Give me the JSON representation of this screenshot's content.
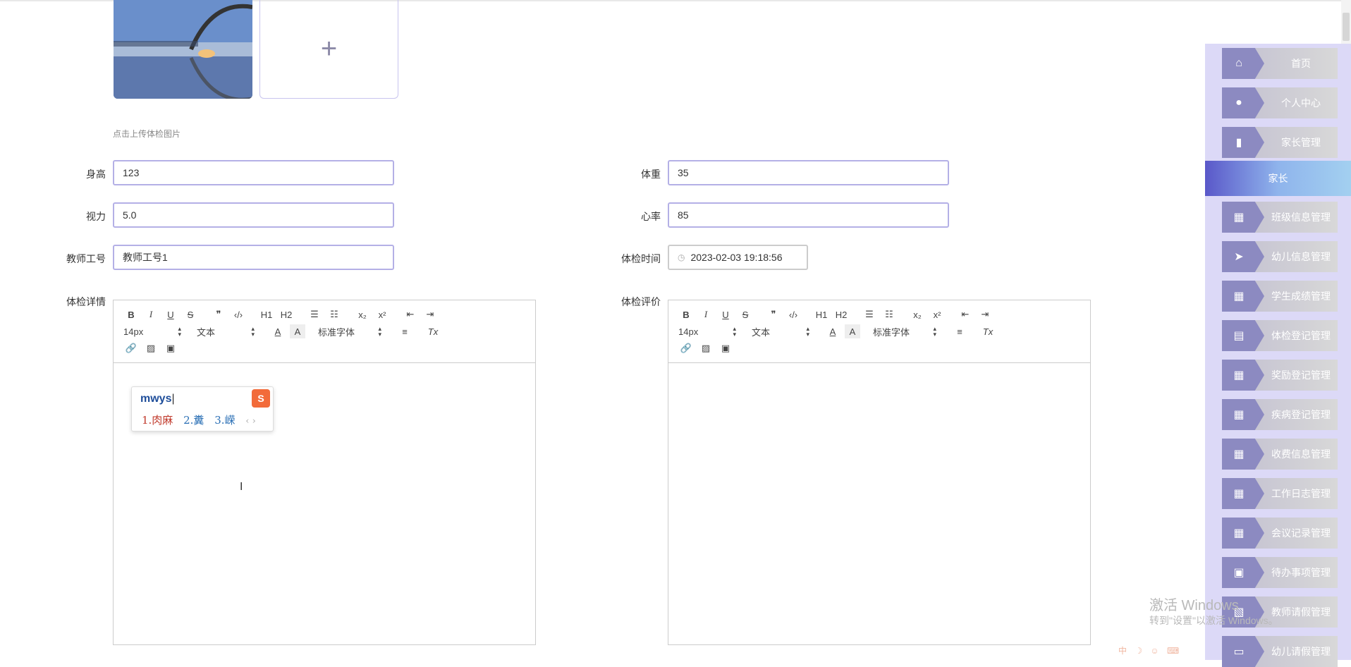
{
  "upload": {
    "hint": "点击上传体检图片",
    "add_symbol": "+"
  },
  "form": {
    "height": {
      "label": "身高",
      "value": "123"
    },
    "weight": {
      "label": "体重",
      "value": "35"
    },
    "vision": {
      "label": "视力",
      "value": "5.0"
    },
    "heart_rate": {
      "label": "心率",
      "value": "85"
    },
    "teacher_id": {
      "label": "教师工号",
      "value": "教师工号1"
    },
    "exam_time": {
      "label": "体检时间",
      "value": "2023-02-03 19:18:56"
    },
    "details": {
      "label": "体检详情"
    },
    "evaluation": {
      "label": "体检评价"
    }
  },
  "editor": {
    "font_size": "14px",
    "paragraph": "文本",
    "font_family": "标准字体",
    "buttons": {
      "bold": "B",
      "italic": "I",
      "underline": "U",
      "strike": "S",
      "quote": "❞",
      "code": "‹/›",
      "h1": "H1",
      "h2": "H2",
      "sub": "x₂",
      "sup": "x²",
      "clean": "Tx"
    }
  },
  "ime": {
    "input": "mwys",
    "candidates": [
      "1.肉麻",
      "2.糞",
      "3.嵘"
    ],
    "nav": "‹ ›",
    "logo": "S"
  },
  "sidebar": {
    "items_top": [
      {
        "label": "首页",
        "icon": "home-icon",
        "glyph": "⌂"
      },
      {
        "label": "个人中心",
        "icon": "user-icon",
        "glyph": "●"
      },
      {
        "label": "家长管理",
        "icon": "bar-chart-icon",
        "glyph": "▮"
      }
    ],
    "active": "家长",
    "items_bottom": [
      {
        "label": "班级信息管理",
        "icon": "grid-icon",
        "glyph": "▦"
      },
      {
        "label": "幼儿信息管理",
        "icon": "send-icon",
        "glyph": "➤"
      },
      {
        "label": "学生成绩管理",
        "icon": "grid-icon",
        "glyph": "▦"
      },
      {
        "label": "体检登记管理",
        "icon": "clipboard-icon",
        "glyph": "▤"
      },
      {
        "label": "奖励登记管理",
        "icon": "grid-icon",
        "glyph": "▦"
      },
      {
        "label": "疾病登记管理",
        "icon": "grid-icon",
        "glyph": "▦"
      },
      {
        "label": "收费信息管理",
        "icon": "grid-icon",
        "glyph": "▦"
      },
      {
        "label": "工作日志管理",
        "icon": "grid-icon",
        "glyph": "▦"
      },
      {
        "label": "会议记录管理",
        "icon": "grid-icon",
        "glyph": "▦"
      },
      {
        "label": "待办事项管理",
        "icon": "briefcase-icon",
        "glyph": "▣"
      },
      {
        "label": "教师请假管理",
        "icon": "document-icon",
        "glyph": "▧"
      },
      {
        "label": "幼儿请假管理",
        "icon": "monitor-icon",
        "glyph": "▭"
      }
    ]
  },
  "watermark": {
    "line1": "激活 Windows",
    "line2": "转到\"设置\"以激活 Windows。"
  },
  "tray": "中 ☽ ☺ ⌨"
}
